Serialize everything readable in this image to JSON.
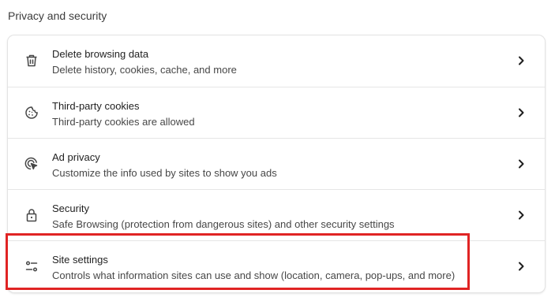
{
  "section": {
    "title": "Privacy and security"
  },
  "items": [
    {
      "title": "Delete browsing data",
      "subtitle": "Delete history, cookies, cache, and more",
      "icon": "trash-icon"
    },
    {
      "title": "Third-party cookies",
      "subtitle": "Third-party cookies are allowed",
      "icon": "cookie-icon"
    },
    {
      "title": "Ad privacy",
      "subtitle": "Customize the info used by sites to show you ads",
      "icon": "ad-privacy-icon"
    },
    {
      "title": "Security",
      "subtitle": "Safe Browsing (protection from dangerous sites) and other security settings",
      "icon": "lock-icon"
    },
    {
      "title": "Site settings",
      "subtitle": "Controls what information sites can use and show (location, camera, pop-ups, and more)",
      "icon": "tune-icon"
    }
  ],
  "colors": {
    "highlight": "#e02424",
    "icon": "#474747",
    "text": "#1f1f1f"
  }
}
